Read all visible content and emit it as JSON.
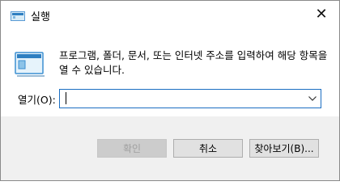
{
  "window": {
    "title": "실행",
    "close_glyph": "✕"
  },
  "main": {
    "description": "프로그램, 폴더, 문서, 또는 인터넷 주소를 입력하여 해당 항목을 열 수 있습니다.",
    "open_label": "열기(O):",
    "open_input_value": ""
  },
  "buttons": {
    "ok": "확인",
    "cancel": "취소",
    "browse": "찾아보기(B)..."
  },
  "icons": {
    "title": "run-icon",
    "run_large": "run-icon",
    "dropdown": "chevron-down-icon",
    "close": "close-icon"
  }
}
